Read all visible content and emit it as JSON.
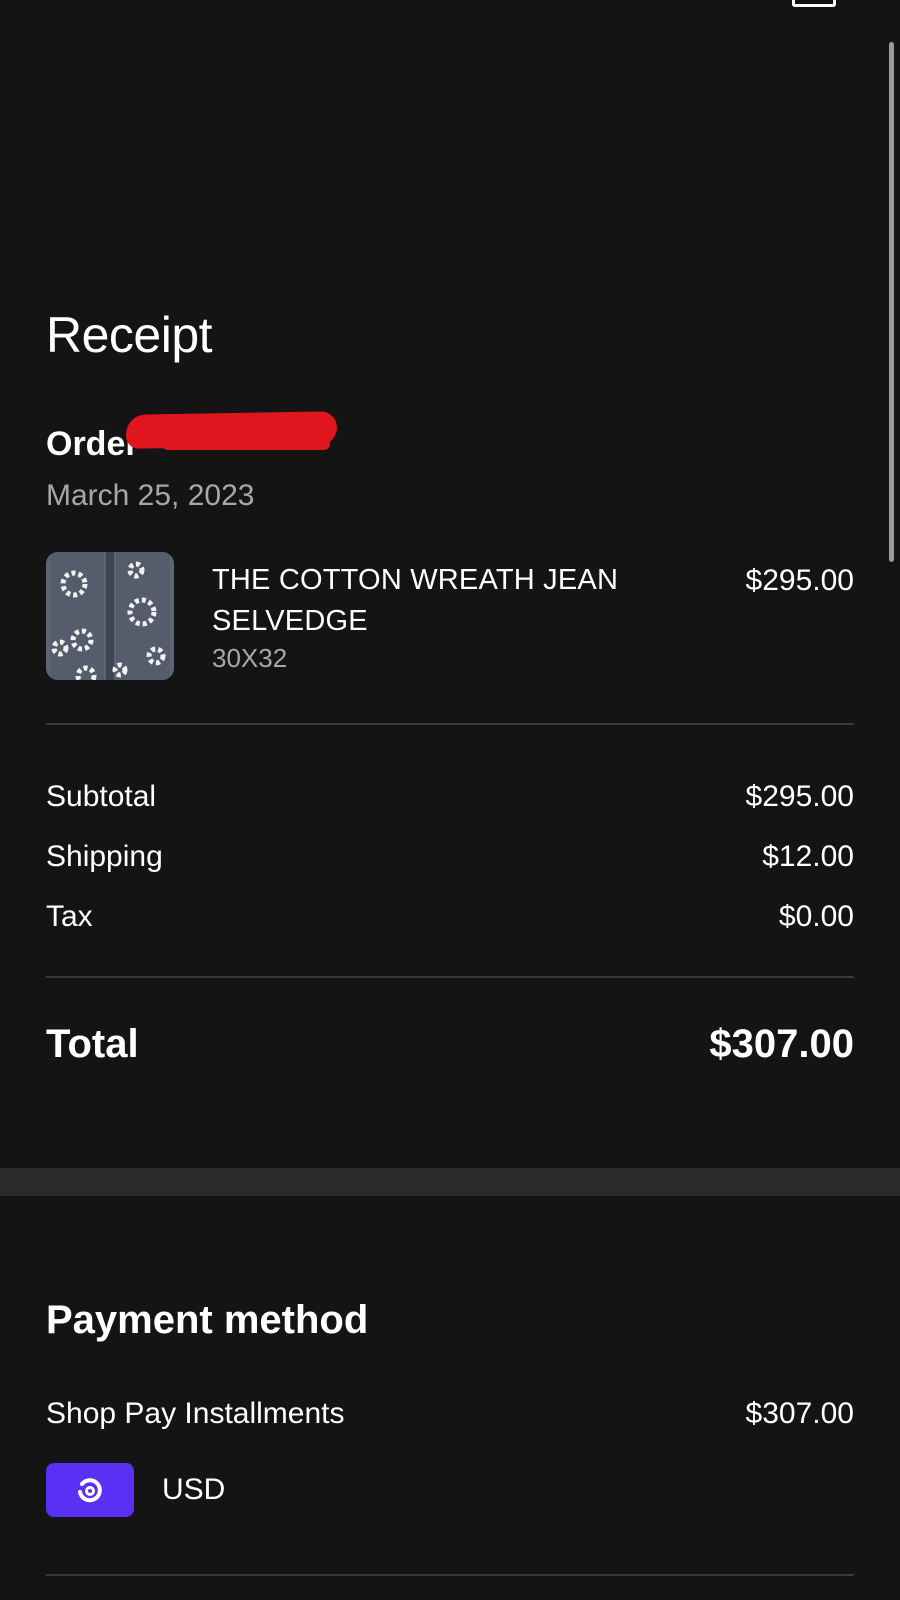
{
  "header": {
    "title": "Receipt",
    "order_label": "Order",
    "order_date": "March 25, 2023"
  },
  "line_items": [
    {
      "name": "THE COTTON WREATH JEAN SELVEDGE",
      "variant": "30X32",
      "price": "$295.00",
      "thumbnail_icon": "jeans-thumbnail"
    }
  ],
  "summary": {
    "subtotal_label": "Subtotal",
    "subtotal_value": "$295.00",
    "shipping_label": "Shipping",
    "shipping_value": "$12.00",
    "tax_label": "Tax",
    "tax_value": "$0.00",
    "total_label": "Total",
    "total_value": "$307.00"
  },
  "payment": {
    "title": "Payment method",
    "method_label": "Shop Pay Installments",
    "method_amount": "$307.00",
    "currency": "USD",
    "badge_icon": "shop-pay-icon"
  },
  "colors": {
    "background": "#141414",
    "text_primary": "#ffffff",
    "text_secondary": "#a8a8a8",
    "divider": "#3a3a3a",
    "shop_pay_purple": "#5a31f4",
    "redaction_red": "#e0161e"
  }
}
